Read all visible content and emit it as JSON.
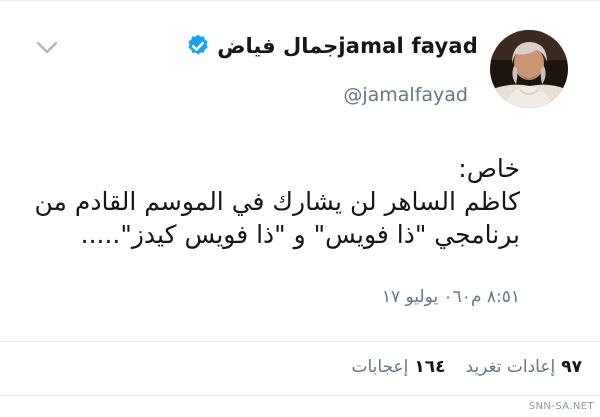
{
  "tweet": {
    "author": {
      "display_name": "جمال فياضjamal fayad",
      "handle": "@jamalfayad",
      "verified_icon": "verified-badge-icon",
      "avatar": "avatar-photo"
    },
    "menu_icon": "chevron-down-icon",
    "text_lines": [
      "خاص:",
      "كاظم الساهر لن يشارك في الموسم القادم من",
      "برنامجي \"ذا فويس\" و \"ذا فويس كيدز\"....."
    ],
    "timestamp": "٨:٥١ م٠٦٠ يوليو ١٧",
    "stats": {
      "retweets_count": "٩٧",
      "retweets_label": "إعادات تغريد",
      "likes_count": "١٦٤",
      "likes_label": "إعجابات"
    }
  },
  "watermark": "SNN-SA.NET",
  "colors": {
    "verified_blue": "#1da1f2",
    "secondary_text": "#657786",
    "primary_text": "#14171a",
    "divider": "#e6ecf0"
  }
}
